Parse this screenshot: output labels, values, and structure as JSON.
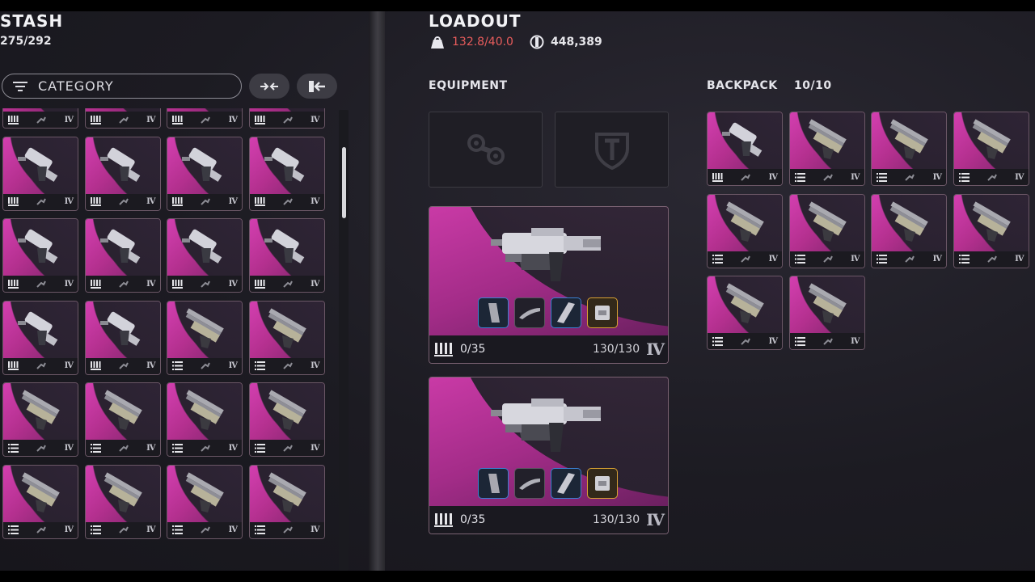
{
  "stash": {
    "title": "STASH",
    "count": "275/292",
    "filter_label": "CATEGORY",
    "items": [
      {
        "gun": "smg",
        "ammo": "bars",
        "tier": "IV"
      },
      {
        "gun": "smg",
        "ammo": "bars",
        "tier": "IV"
      },
      {
        "gun": "smg",
        "ammo": "bars",
        "tier": "IV"
      },
      {
        "gun": "smg",
        "ammo": "bars",
        "tier": "IV"
      },
      {
        "gun": "smg",
        "ammo": "bars",
        "tier": "IV"
      },
      {
        "gun": "smg",
        "ammo": "bars",
        "tier": "IV"
      },
      {
        "gun": "smg",
        "ammo": "bars",
        "tier": "IV"
      },
      {
        "gun": "smg",
        "ammo": "bars",
        "tier": "IV"
      },
      {
        "gun": "smg",
        "ammo": "bars",
        "tier": "IV"
      },
      {
        "gun": "smg",
        "ammo": "bars",
        "tier": "IV"
      },
      {
        "gun": "smg",
        "ammo": "bars",
        "tier": "IV"
      },
      {
        "gun": "smg",
        "ammo": "bars",
        "tier": "IV"
      },
      {
        "gun": "smg",
        "ammo": "bars",
        "tier": "IV"
      },
      {
        "gun": "smg",
        "ammo": "bars",
        "tier": "IV"
      },
      {
        "gun": "rifle",
        "ammo": "lines",
        "tier": "IV"
      },
      {
        "gun": "rifle",
        "ammo": "lines",
        "tier": "IV"
      },
      {
        "gun": "rifle",
        "ammo": "lines",
        "tier": "IV"
      },
      {
        "gun": "rifle",
        "ammo": "lines",
        "tier": "IV"
      },
      {
        "gun": "rifle",
        "ammo": "lines",
        "tier": "IV"
      },
      {
        "gun": "rifle",
        "ammo": "lines",
        "tier": "IV"
      },
      {
        "gun": "rifle",
        "ammo": "lines",
        "tier": "IV"
      },
      {
        "gun": "rifle",
        "ammo": "lines",
        "tier": "IV"
      },
      {
        "gun": "rifle",
        "ammo": "lines",
        "tier": "IV"
      },
      {
        "gun": "rifle",
        "ammo": "lines",
        "tier": "IV"
      }
    ]
  },
  "loadout": {
    "title": "LOADOUT",
    "weight": "132.8/40.0",
    "currency": "448,389",
    "equipment_label": "EQUIPMENT",
    "weapons": [
      {
        "ammo": "0/35",
        "durability": "130/130",
        "tier": "IV"
      },
      {
        "ammo": "0/35",
        "durability": "130/130",
        "tier": "IV"
      }
    ]
  },
  "backpack": {
    "label": "BACKPACK",
    "count": "10/10",
    "items": [
      {
        "gun": "smg",
        "ammo": "bars",
        "tier": "IV"
      },
      {
        "gun": "rifle",
        "ammo": "lines",
        "tier": "IV"
      },
      {
        "gun": "rifle",
        "ammo": "lines",
        "tier": "IV"
      },
      {
        "gun": "rifle",
        "ammo": "lines",
        "tier": "IV"
      },
      {
        "gun": "rifle",
        "ammo": "lines",
        "tier": "IV"
      },
      {
        "gun": "rifle",
        "ammo": "lines",
        "tier": "IV"
      },
      {
        "gun": "rifle",
        "ammo": "lines",
        "tier": "IV"
      },
      {
        "gun": "rifle",
        "ammo": "lines",
        "tier": "IV"
      },
      {
        "gun": "rifle",
        "ammo": "lines",
        "tier": "IV"
      },
      {
        "gun": "rifle",
        "ammo": "lines",
        "tier": "IV"
      }
    ]
  },
  "colors": {
    "accent": "#d33fb0",
    "warning": "#e85c5c",
    "mod_blue": "#3a7fd0",
    "mod_gold": "#d6a032"
  }
}
